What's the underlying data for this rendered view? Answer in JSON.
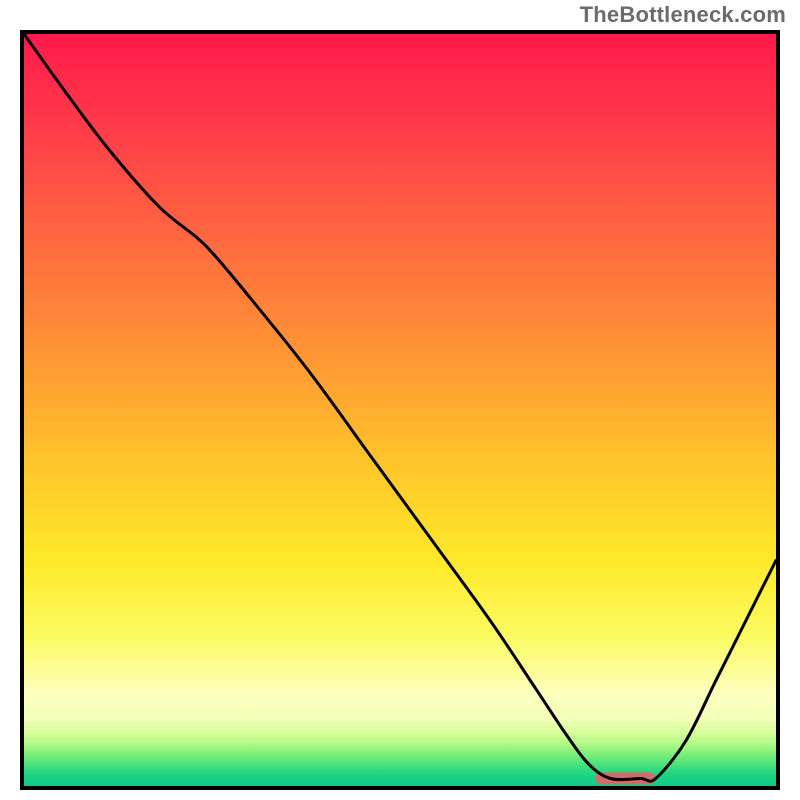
{
  "watermark": "TheBottleneck.com",
  "chart_data": {
    "type": "line",
    "title": "",
    "xlabel": "",
    "ylabel": "",
    "xlim": [
      0,
      100
    ],
    "ylim": [
      0,
      100
    ],
    "grid": false,
    "legend": false,
    "series": [
      {
        "name": "bottleneck-curve",
        "x": [
          0,
          5,
          11,
          18,
          24,
          30,
          38,
          46,
          54,
          62,
          68,
          72,
          75,
          78,
          82,
          84,
          88,
          92,
          96,
          100
        ],
        "values": [
          100,
          93,
          85,
          77,
          72,
          65,
          55,
          44,
          33,
          22,
          13,
          7,
          3,
          1,
          1,
          1,
          6,
          14,
          22,
          30
        ]
      }
    ],
    "marker": {
      "name": "optimal-range",
      "x_start": 76,
      "x_end": 84,
      "y": 1
    },
    "background_gradient_stops": [
      {
        "pct": 0,
        "color": "#ff1a4b"
      },
      {
        "pct": 28,
        "color": "#ff6a3f"
      },
      {
        "pct": 58,
        "color": "#ffc82a"
      },
      {
        "pct": 80,
        "color": "#fbfb60"
      },
      {
        "pct": 91,
        "color": "#f3ffb6"
      },
      {
        "pct": 97,
        "color": "#50e47a"
      },
      {
        "pct": 100,
        "color": "#10cc84"
      }
    ]
  }
}
